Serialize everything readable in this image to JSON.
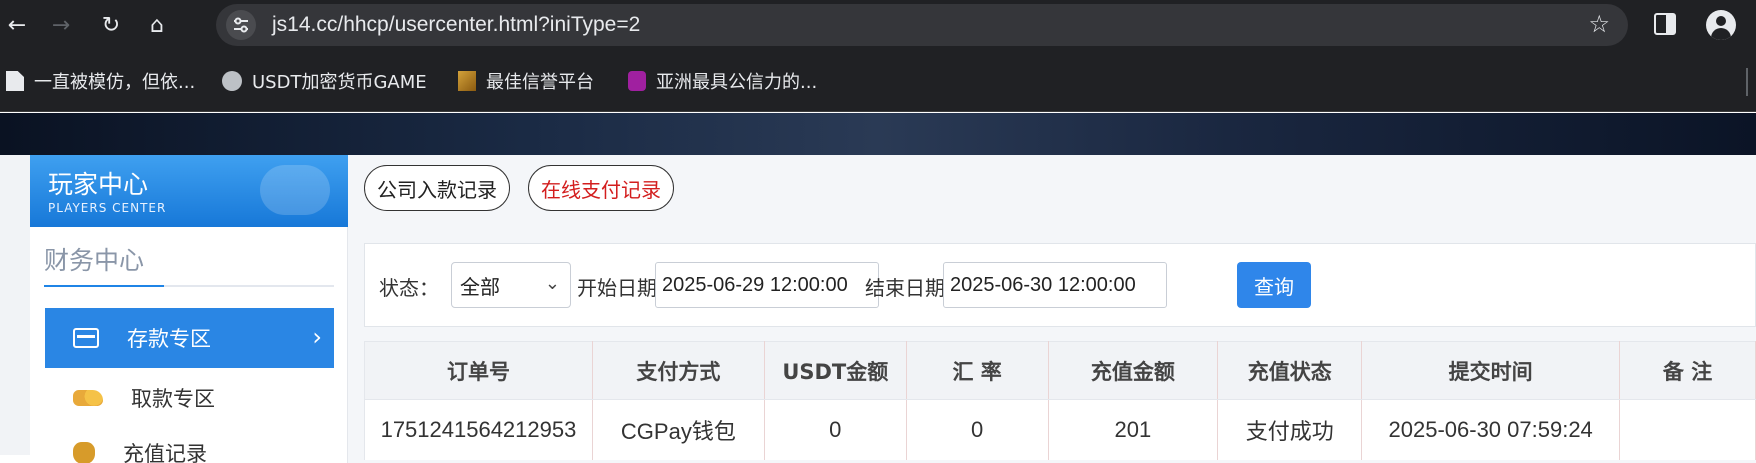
{
  "browser": {
    "url": "js14.cc/hhcp/usercenter.html?iniType=2",
    "bookmarks": [
      {
        "label": "一直被模仿，但依...",
        "icon": "document-icon"
      },
      {
        "label": "USDT加密货币GAME",
        "icon": "globe-icon"
      },
      {
        "label": "最佳信誉平台",
        "icon": "brand-icon"
      },
      {
        "label": "亚洲最具公信力的...",
        "icon": "atom-icon"
      }
    ]
  },
  "sidebar": {
    "title": "玩家中心",
    "subtitle": "PLAYERS CENTER",
    "section": "财务中心",
    "items": [
      {
        "label": "存款专区",
        "active": true
      },
      {
        "label": "取款专区",
        "active": false
      },
      {
        "label": "充值记录",
        "active": false
      }
    ]
  },
  "tabs": {
    "company": "公司入款记录",
    "online": "在线支付记录"
  },
  "filter": {
    "status_label": "状态：",
    "status_value": "全部",
    "start_label": "开始日期:",
    "start_value": "2025-06-29 12:00:00",
    "end_label": "结束日期:",
    "end_value": "2025-06-30 12:00:00",
    "query_label": "查询"
  },
  "table": {
    "headers": [
      "订单号",
      "支付方式",
      "USDT金额",
      "汇 率",
      "充值金额",
      "充值状态",
      "提交时间",
      "备 注"
    ],
    "rows": [
      [
        "1751241564212953",
        "CGPay钱包",
        "0",
        "0",
        "201",
        "支付成功",
        "2025-06-30 07:59:24",
        ""
      ]
    ]
  },
  "colors": {
    "accent": "#2a86e4",
    "danger": "#d31e1e",
    "chrome_bg": "#202124"
  }
}
